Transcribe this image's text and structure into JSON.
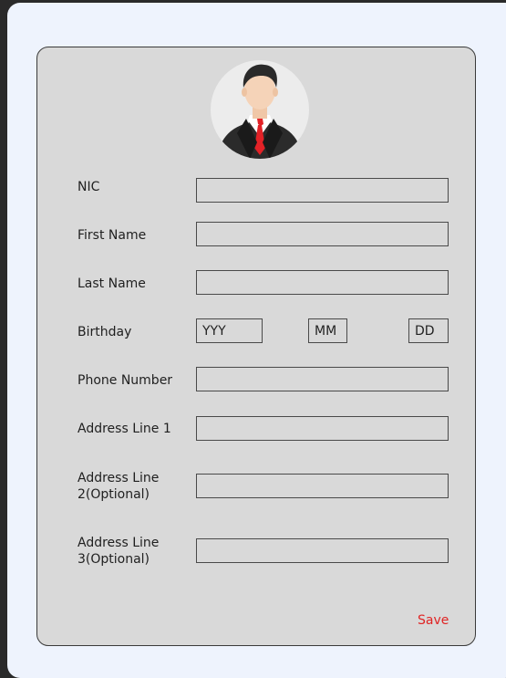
{
  "form": {
    "fields": {
      "nic": {
        "label": "NIC",
        "value": ""
      },
      "first_name": {
        "label": "First Name",
        "value": ""
      },
      "last_name": {
        "label": "Last Name",
        "value": ""
      },
      "birthday": {
        "label": "Birthday",
        "year_placeholder": "YYY",
        "month_placeholder": "MM",
        "day_placeholder": "DD"
      },
      "phone": {
        "label": "Phone Number",
        "value": ""
      },
      "address1": {
        "label": "Address Line 1",
        "value": ""
      },
      "address2": {
        "label_line1": "Address Line",
        "label_line2": "2(Optional)",
        "value": ""
      },
      "address3": {
        "label_line1": "Address Line",
        "label_line2": "3(Optional)",
        "value": ""
      }
    },
    "save_label": "Save"
  },
  "colors": {
    "page_bg": "#eef3fd",
    "card_bg": "#d9d9d9",
    "save_text": "#e02424",
    "tie": "#e32227"
  },
  "icons": {
    "avatar": "user-avatar-icon"
  }
}
